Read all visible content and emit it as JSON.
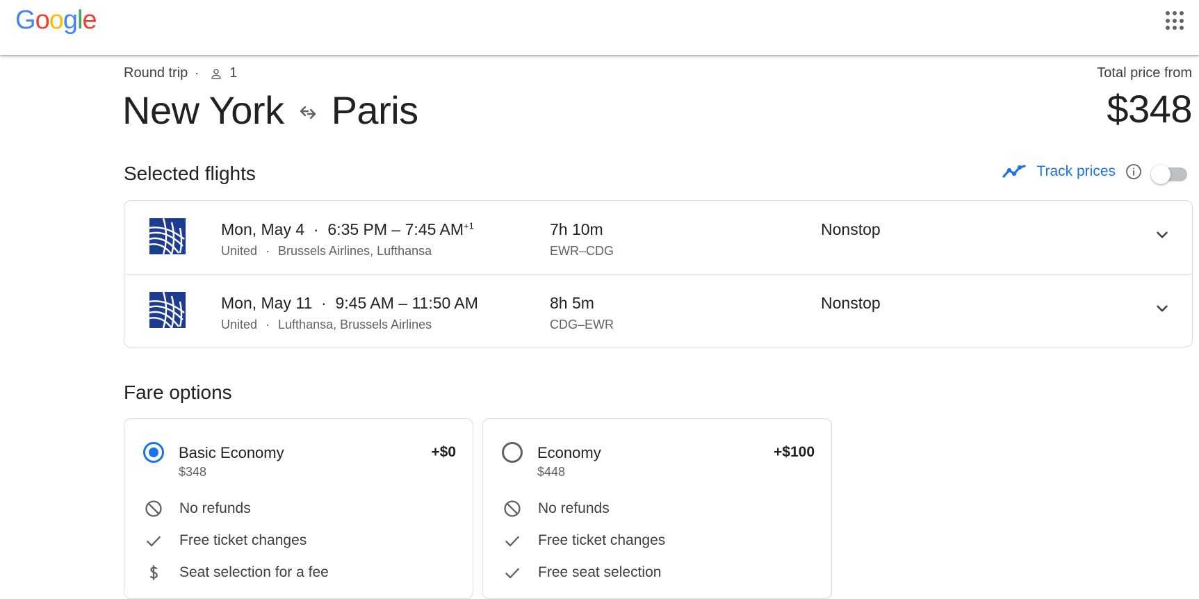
{
  "app": {
    "logo_letters": [
      "G",
      "o",
      "o",
      "g",
      "l",
      "e"
    ],
    "logo_colors": [
      "#4285f4",
      "#ea4335",
      "#fbbc05",
      "#4285f4",
      "#34a853",
      "#ea4335"
    ],
    "apps_icon": "apps-grid-icon"
  },
  "trip": {
    "type": "Round trip",
    "passengers": "1",
    "origin": "New York",
    "destination": "Paris",
    "total_label": "Total price from",
    "total_price": "$348"
  },
  "selected_flights": {
    "title": "Selected flights",
    "track_prices_label": "Track prices",
    "track_enabled": false,
    "flights": [
      {
        "date": "Mon, May 4",
        "times": "6:35 PM – 7:45 AM",
        "day_offset": "+1",
        "airline": "United",
        "operators": "Brussels Airlines, Lufthansa",
        "duration": "7h 10m",
        "airports": "EWR–CDG",
        "stops": "Nonstop"
      },
      {
        "date": "Mon, May 11",
        "times": "9:45 AM – 11:50 AM",
        "day_offset": "",
        "airline": "United",
        "operators": "Lufthansa, Brussels Airlines",
        "duration": "8h 5m",
        "airports": "CDG–EWR",
        "stops": "Nonstop"
      }
    ]
  },
  "fare_options": {
    "title": "Fare options",
    "fares": [
      {
        "name": "Basic Economy",
        "price": "$348",
        "delta": "+$0",
        "selected": true,
        "features": [
          {
            "icon": "no-refund-icon",
            "label": "No refunds"
          },
          {
            "icon": "check-icon",
            "label": "Free ticket changes"
          },
          {
            "icon": "dollar-icon",
            "label": "Seat selection for a fee"
          }
        ]
      },
      {
        "name": "Economy",
        "price": "$448",
        "delta": "+$100",
        "selected": false,
        "features": [
          {
            "icon": "no-refund-icon",
            "label": "No refunds"
          },
          {
            "icon": "check-icon",
            "label": "Free ticket changes"
          },
          {
            "icon": "check-icon",
            "label": "Free seat selection"
          }
        ]
      }
    ]
  },
  "colors": {
    "accent": "#1a73e8",
    "airline_logo": "#1d3c8f",
    "border": "#dadce0",
    "muted_text": "#5f6368"
  }
}
